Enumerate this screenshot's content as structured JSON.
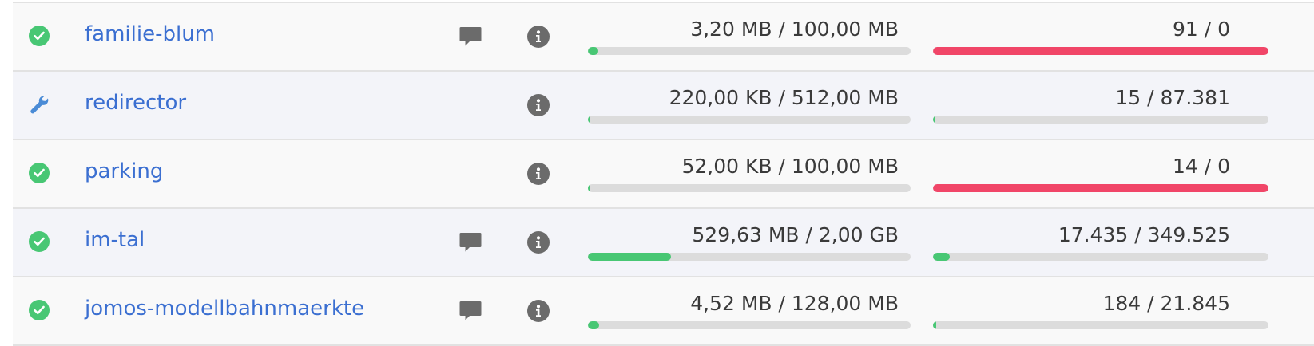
{
  "colors": {
    "ok": "#48c774",
    "danger": "#f14668",
    "link": "#3b6fd1",
    "wrench": "#4a8bd6",
    "bar_track": "#dcdcdc"
  },
  "rows": [
    {
      "status_icon": "check-circle-icon",
      "name": "familie-blum",
      "has_comment": true,
      "storage_text": "3,20 MB / 100,00 MB",
      "storage_fraction": 0.032,
      "storage_color": "green",
      "count_text": "91 / 0",
      "count_fraction": 1.0,
      "count_color": "red"
    },
    {
      "status_icon": "wrench-icon",
      "name": "redirector",
      "has_comment": false,
      "storage_text": "220,00 KB / 512,00 MB",
      "storage_fraction": 0.0004,
      "storage_color": "green",
      "count_text": "15 / 87.381",
      "count_fraction": 0.0002,
      "count_color": "green"
    },
    {
      "status_icon": "check-circle-icon",
      "name": "parking",
      "has_comment": false,
      "storage_text": "52,00 KB / 100,00 MB",
      "storage_fraction": 0.0005,
      "storage_color": "green",
      "count_text": "14 / 0",
      "count_fraction": 1.0,
      "count_color": "red"
    },
    {
      "status_icon": "check-circle-icon",
      "name": "im-tal",
      "has_comment": true,
      "storage_text": "529,63 MB / 2,00 GB",
      "storage_fraction": 0.2586,
      "storage_color": "green",
      "count_text": "17.435 / 349.525",
      "count_fraction": 0.0499,
      "count_color": "green"
    },
    {
      "status_icon": "check-circle-icon",
      "name": "jomos-modellbahnmaerkte",
      "has_comment": true,
      "storage_text": "4,52 MB / 128,00 MB",
      "storage_fraction": 0.0353,
      "storage_color": "green",
      "count_text": "184 / 21.845",
      "count_fraction": 0.0084,
      "count_color": "green"
    }
  ]
}
